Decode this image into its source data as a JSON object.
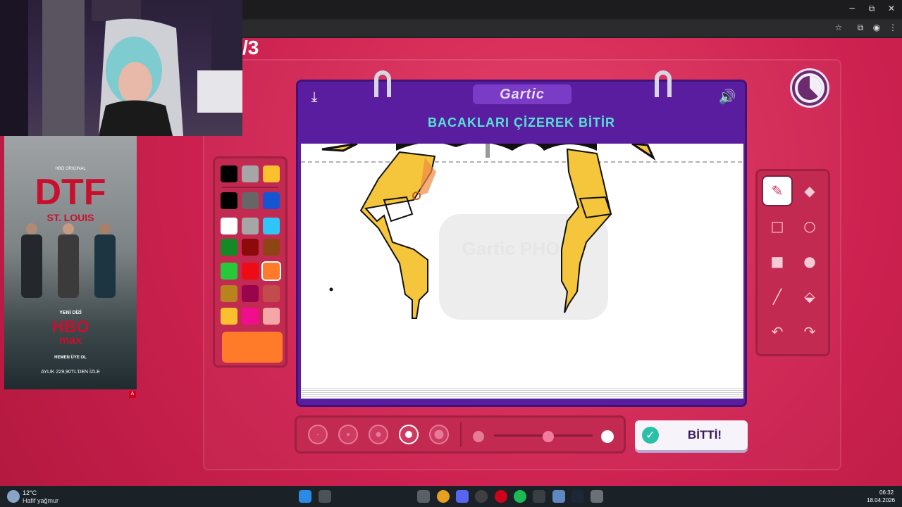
{
  "browser": {
    "window_controls": {
      "minimize": "−",
      "restore": "⧉",
      "close": "✕"
    },
    "toolbar_icons": [
      "star-icon",
      "cast-icon",
      "profile-icon",
      "menu-icon"
    ]
  },
  "game": {
    "round_indicator": "/3",
    "logo": "Gartic",
    "prompt": "BACAKLARI ÇİZEREK BİTİR",
    "watermark": "Gartic PHONE",
    "done_button": "BİTTİ!",
    "palette": {
      "colors": [
        "#000000",
        "#a6a6a6",
        "#fbc02d",
        "#000000",
        "#666666",
        "#1456d1",
        "#ffffff",
        "#a6a6a6",
        "#30c5f7",
        "#138a26",
        "#8c0a0a",
        "#8e4513",
        "#25c93a",
        "#ef0b14",
        "#ff7a29",
        "#b8831e",
        "#99054d",
        "#c24c4c",
        "#fbc02d",
        "#f00e8e",
        "#f5a6a6"
      ],
      "selected": "#ff7a29"
    },
    "tools": [
      "pencil-icon",
      "eraser-icon",
      "rectangle-outline-icon",
      "ellipse-outline-icon",
      "rectangle-fill-icon",
      "ellipse-fill-icon",
      "line-icon",
      "fill-bucket-icon",
      "undo-icon",
      "redo-icon"
    ],
    "selected_tool": "pencil-icon",
    "brush_sizes": 5,
    "selected_brush_size": 4,
    "opacity_level": 0.55
  },
  "taskbar": {
    "temperature": "12°C",
    "weather": "Hafif yağmur",
    "time": "06:32",
    "date": "18.04.2026"
  },
  "ad": {
    "label": "HBO ORIGINAL",
    "title": "DTF",
    "subtitle": "ST. LOUIS",
    "tag": "YENİ DİZİ",
    "brand1": "HBO",
    "brand2": "max",
    "price": "AYLIK 229,90TL'DEN İZLE",
    "cta": "HEMEN ÜYE OL"
  }
}
